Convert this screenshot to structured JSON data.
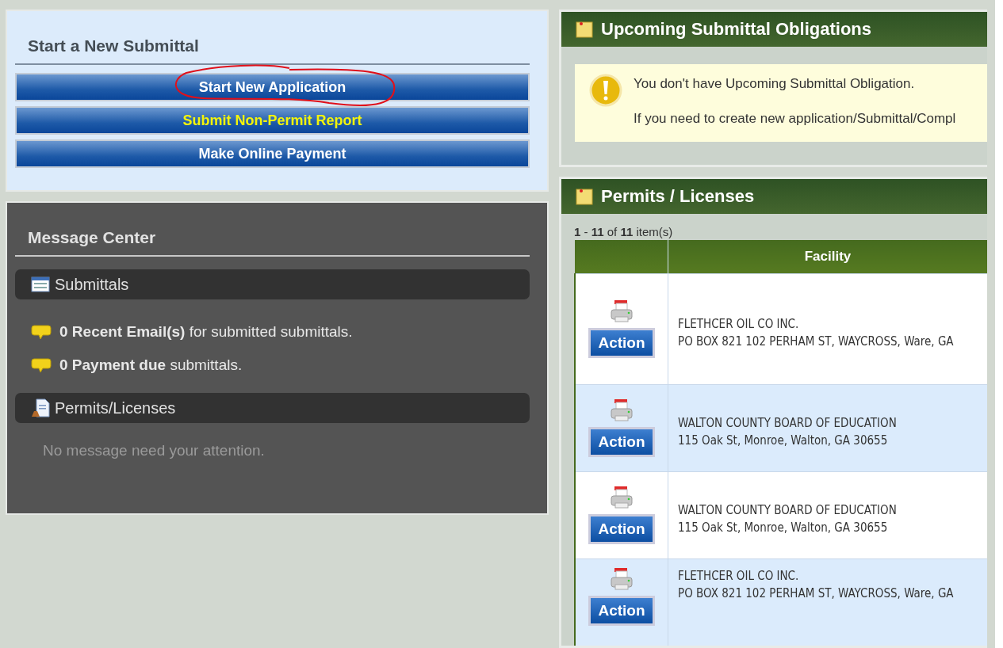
{
  "new_submittal": {
    "title": "Start a New Submittal",
    "buttons": [
      {
        "label": "Start New Application",
        "emphasis": false,
        "circled": true
      },
      {
        "label": "Submit Non-Permit Report",
        "emphasis": true,
        "circled": false
      },
      {
        "label": "Make Online Payment",
        "emphasis": false,
        "circled": false
      }
    ]
  },
  "message_center": {
    "title": "Message Center",
    "sections": [
      {
        "kind": "submittals",
        "title": "Submittals",
        "messages": [
          "**0 Recent Email(s)** for submitted submittals.",
          "**0 Payment due** submittals."
        ]
      },
      {
        "kind": "permits",
        "title": "Permits/Licenses",
        "note": "No message need your attention."
      }
    ]
  },
  "obligations": {
    "title": "Upcoming Submittal Obligations",
    "lines": [
      "You don't have Upcoming Submittal Obligation.",
      "If you need to create new application/Submittal/Compl"
    ]
  },
  "permits": {
    "title": "Permits / Licenses",
    "count": "**1** - **11** of **11** item(s)",
    "columns": [
      "Facility"
    ],
    "rows": [
      {
        "action": "Action",
        "name": "FLETHCER OIL CO INC.",
        "address": "PO BOX 821 102 PERHAM ST, WAYCROSS, Ware, GA"
      },
      {
        "action": "Action",
        "name": "WALTON COUNTY BOARD OF EDUCATION",
        "address": "115 Oak St, Monroe, Walton, GA 30655"
      },
      {
        "action": "Action",
        "name": "WALTON COUNTY BOARD OF EDUCATION",
        "address": "115 Oak St, Monroe, Walton, GA 30655"
      },
      {
        "action": "Action",
        "name": "FLETHCER OIL CO INC.",
        "address": "PO BOX 821 102 PERHAM ST, WAYCROSS, Ware, GA"
      }
    ]
  }
}
